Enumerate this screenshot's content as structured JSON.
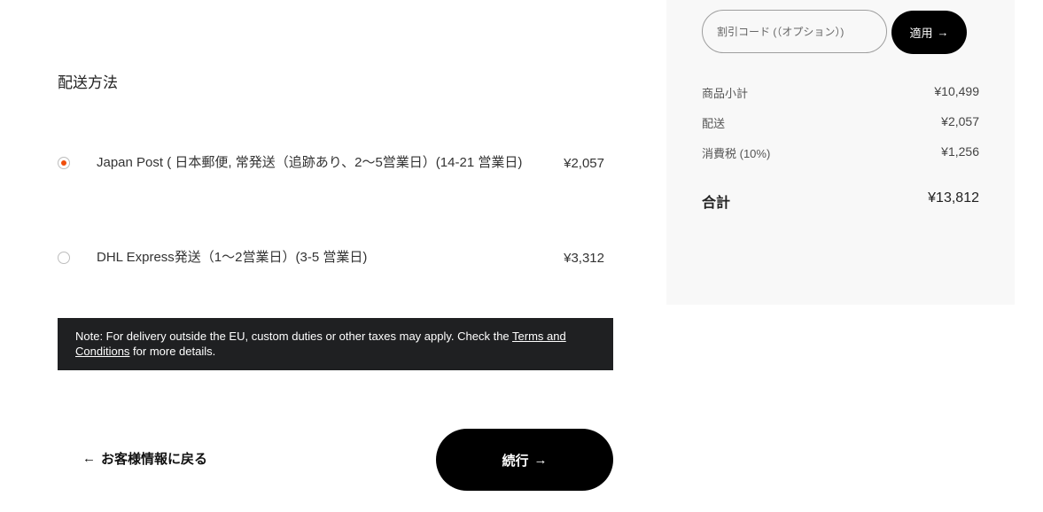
{
  "shipping": {
    "title": "配送方法",
    "options": [
      {
        "label": "Japan Post ( 日本郵便, 常発送（追跡あり、2〜5営業日）(14-21 営業日)",
        "price": "¥2,057",
        "selected": true
      },
      {
        "label": "DHL Express発送（1〜2営業日）(3-5 営業日)",
        "price": "¥3,312",
        "selected": false
      }
    ],
    "accent_color": "#f04e0c"
  },
  "note": {
    "prefix": "Note: For delivery outside the EU, custom duties or other taxes may apply. Check the ",
    "link": "Terms and Conditions",
    "suffix": " for more details."
  },
  "actions": {
    "back_label": "お客様情報に戻る",
    "back_icon": "←",
    "continue_label": "続行",
    "continue_icon": "→"
  },
  "summary": {
    "coupon_placeholder": "割引コード (（オプション）)",
    "apply_label": "適用",
    "apply_icon": "→",
    "rows": [
      {
        "label": "商品小計",
        "value": "¥10,499"
      },
      {
        "label": "配送",
        "value": "¥2,057"
      },
      {
        "label": "消費税 (10%)",
        "value": "¥1,256"
      }
    ],
    "total": {
      "label": "合計",
      "value": "¥13,812"
    }
  }
}
